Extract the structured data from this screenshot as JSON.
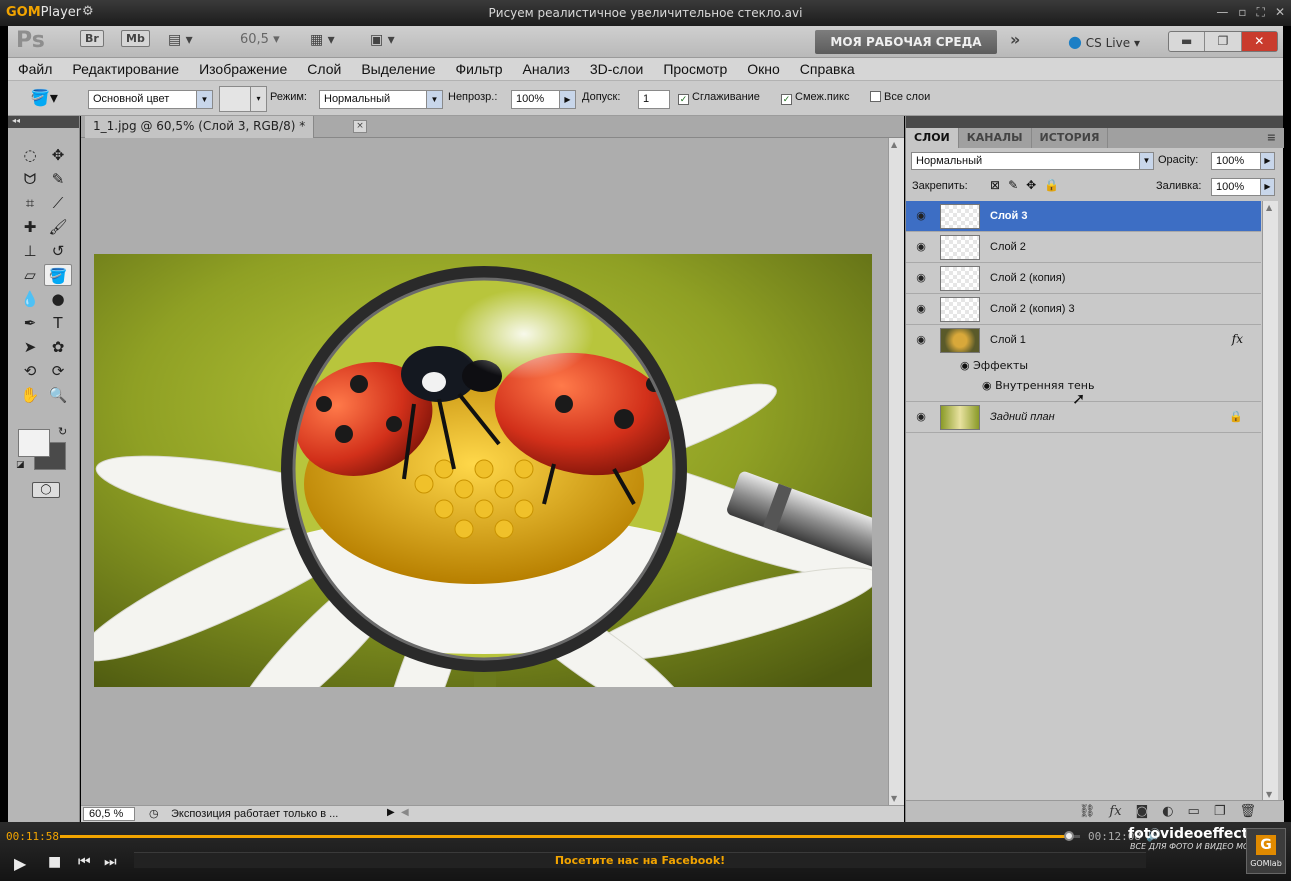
{
  "player": {
    "logo_gom": "GOM",
    "logo_player": "Player",
    "file_title": "Рисуем реалистичное увеличительное стекло.avi",
    "time_current": "00:11:58",
    "time_total": "00:12:08",
    "progress": 0.99,
    "facebook_link": "Посетите нас на Facebook!",
    "watermark_site": "fotovideoeffect.com",
    "watermark_slogan": "ВСЕ ДЛЯ ФОТО И ВИДЕО МОНТАЖА!",
    "badge_label": "GOMlab",
    "accent_color": "#f2a400"
  },
  "appbar": {
    "ps_logo": "Ps",
    "bridge": "Br",
    "minibridge": "Mb",
    "zoom_value": "60,5",
    "workspace": "МОЯ РАБОЧАЯ СРЕДА",
    "more": "»",
    "cs_live": "CS Live"
  },
  "menu": [
    "Файл",
    "Редактирование",
    "Изображение",
    "Слой",
    "Выделение",
    "Фильтр",
    "Анализ",
    "3D-слои",
    "Просмотр",
    "Окно",
    "Справка"
  ],
  "options": {
    "fill_source": "Основной цвет",
    "mode_label": "Режим:",
    "mode_value": "Нормальный",
    "opacity_label": "Непрозр.:",
    "opacity_value": "100%",
    "tolerance_label": "Допуск:",
    "tolerance_value": "1",
    "antialias": "Сглаживание",
    "contiguous": "Смеж.пикс",
    "all_layers": "Все слои"
  },
  "document": {
    "tab_title": "1_1.jpg @ 60,5% (Слой 3, RGB/8) *",
    "close_label": "×",
    "zoom": "60,5 %",
    "status_message": "Экспозиция работает только в ..."
  },
  "layers_panel": {
    "tabs": [
      "СЛОИ",
      "КАНАЛЫ",
      "ИСТОРИЯ"
    ],
    "blend_mode": "Нормальный",
    "opacity_label": "Opacity:",
    "opacity_value": "100%",
    "lock_label": "Закрепить:",
    "fill_label": "Заливка:",
    "fill_value": "100%",
    "layers": [
      {
        "name": "Слой 3",
        "selected": true
      },
      {
        "name": "Слой 2",
        "selected": false
      },
      {
        "name": "Слой 2 (копия)",
        "selected": false
      },
      {
        "name": "Слой 2 (копия) 3",
        "selected": false
      },
      {
        "name": "Слой 1",
        "selected": false,
        "fx": "fx"
      },
      {
        "name": "Задний план",
        "selected": false
      }
    ],
    "effects_label": "Эффекты",
    "effect_item": "Внутренняя тень",
    "selection_color": "#3d6ec4"
  }
}
